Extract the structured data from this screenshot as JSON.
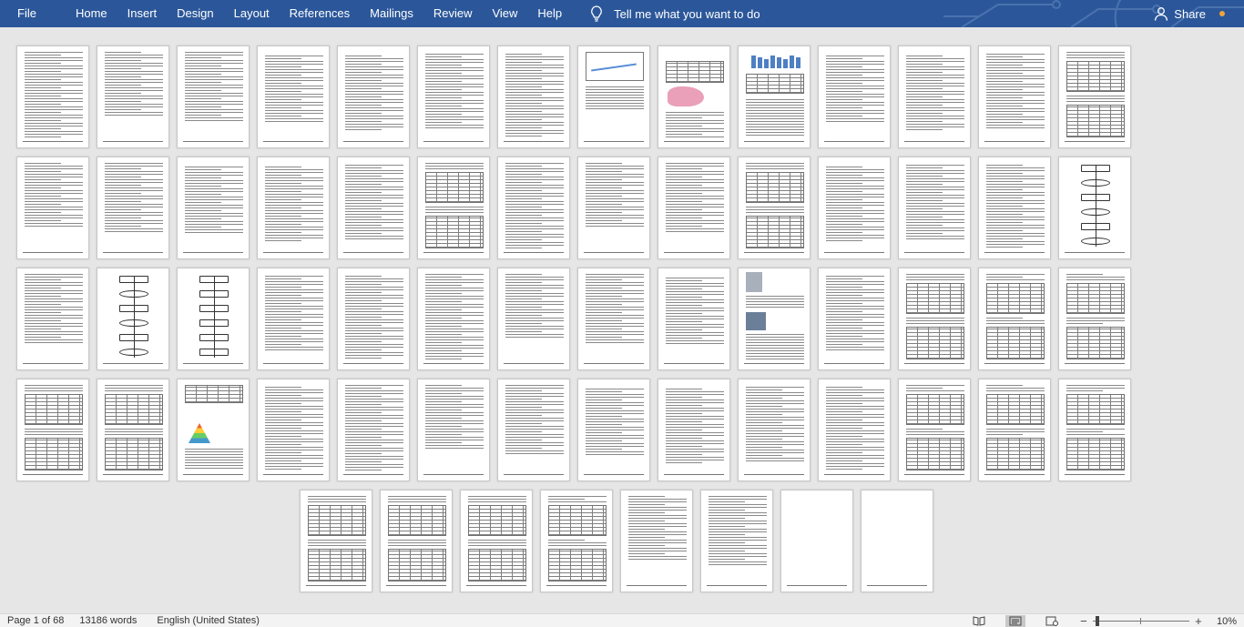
{
  "ribbon": {
    "tabs": [
      "File",
      "Home",
      "Insert",
      "Design",
      "Layout",
      "References",
      "Mailings",
      "Review",
      "View",
      "Help"
    ],
    "tell_me": "Tell me what you want to do",
    "share": "Share",
    "colors": {
      "ribbon_bg": "#2b579a",
      "notification_dot": "#f0a23c"
    }
  },
  "document": {
    "page_count_shown": 68,
    "rows": [
      14,
      14,
      14,
      14,
      8
    ]
  },
  "status": {
    "page": "Page 1 of 68",
    "words": "13186 words",
    "language": "English (United States)",
    "zoom_minus": "−",
    "zoom_plus": "+",
    "zoom": "10%",
    "zoom_level_percent": 10
  }
}
